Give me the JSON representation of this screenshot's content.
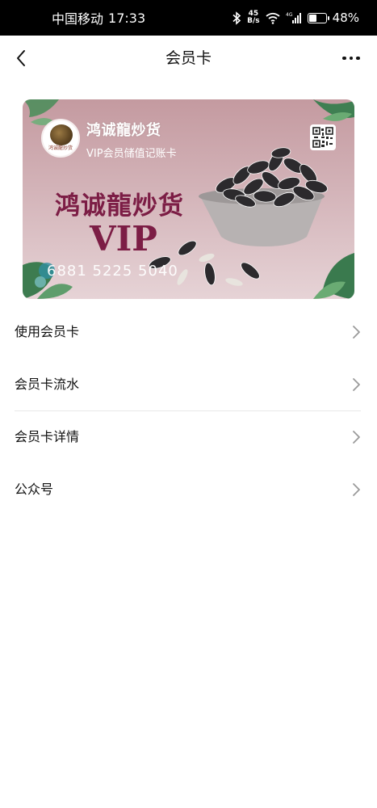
{
  "status_bar": {
    "carrier": "中国移动",
    "time": "17:33",
    "net_speed_value": "45",
    "net_speed_unit": "B/s",
    "network_type": "4G",
    "battery_percent": 48,
    "battery_text": "48%"
  },
  "nav": {
    "title": "会员卡",
    "back_icon": "chevron-left-icon",
    "more_icon": "more-dots-icon"
  },
  "card": {
    "store_name": "鸿诚龍炒货",
    "subtitle": "VIP会员储值记账卡",
    "logo_text": "鸿诚龍炒货",
    "headline": "鸿诚龍炒货",
    "vip_text": "VIP",
    "card_number": "6881 5225 5040",
    "colors": {
      "background_top": "#c49aa0",
      "headline": "#7c1d45"
    }
  },
  "menu": {
    "items": [
      {
        "label": "使用会员卡"
      },
      {
        "label": "会员卡流水"
      },
      {
        "label": "会员卡详情"
      },
      {
        "label": "公众号"
      }
    ]
  }
}
